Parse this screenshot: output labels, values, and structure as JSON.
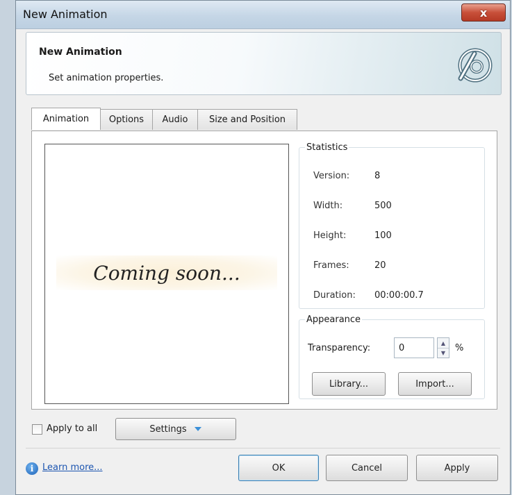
{
  "window": {
    "title": "New Animation",
    "close_symbol": "x"
  },
  "header": {
    "title": "New Animation",
    "subtitle": "Set animation properties."
  },
  "tabs": [
    {
      "label": "Animation",
      "active": true
    },
    {
      "label": "Options",
      "active": false
    },
    {
      "label": "Audio",
      "active": false
    },
    {
      "label": "Size and Position",
      "active": false
    }
  ],
  "preview": {
    "text": "Coming soon..."
  },
  "statistics": {
    "legend": "Statistics",
    "rows": [
      {
        "label": "Version:",
        "value": "8"
      },
      {
        "label": "Width:",
        "value": "500"
      },
      {
        "label": "Height:",
        "value": "100"
      },
      {
        "label": "Frames:",
        "value": "20"
      },
      {
        "label": "Duration:",
        "value": "00:00:00.7"
      }
    ]
  },
  "appearance": {
    "legend": "Appearance",
    "transparency_label": "Transparency:",
    "transparency_value": "0",
    "unit": "%",
    "library_label": "Library...",
    "import_label": "Import..."
  },
  "footer": {
    "apply_all_label": "Apply to all",
    "apply_all_checked": false,
    "settings_label": "Settings",
    "learn_more": "Learn more...",
    "ok_label": "OK",
    "cancel_label": "Cancel",
    "apply_label": "Apply"
  },
  "icons": {
    "logo": "animation-logo-icon",
    "close": "close-icon",
    "info": "info-icon",
    "dropdown": "chevron-down-icon"
  },
  "colors": {
    "accent": "#3c7fb1",
    "close_button": "#c8503a",
    "link": "#1c55b0"
  }
}
